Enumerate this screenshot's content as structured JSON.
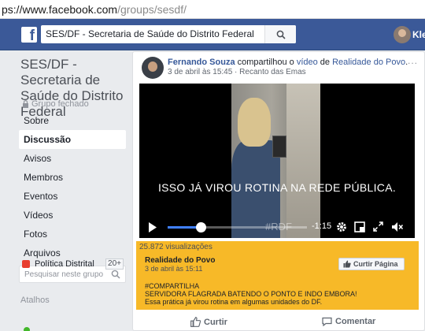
{
  "browser": {
    "url_host": "ps://www.facebook.com",
    "url_path": "/groups/sesdf/"
  },
  "topbar": {
    "logo": "f",
    "search_value": "SES/DF - Secretaria de Saúde do Distrito Federal",
    "user_name": "Kleb"
  },
  "sidebar": {
    "group_name": "SES/DF - Secretaria de Saúde do Distrito Federal",
    "group_status": "Grupo fechado",
    "nav": [
      {
        "label": "Sobre"
      },
      {
        "label": "Discussão",
        "active": true
      },
      {
        "label": "Avisos"
      },
      {
        "label": "Membros"
      },
      {
        "label": "Eventos"
      },
      {
        "label": "Vídeos"
      },
      {
        "label": "Fotos"
      },
      {
        "label": "Arquivos"
      }
    ],
    "search_placeholder": "Pesquisar neste grupo",
    "shortcuts_label": "Atalhos",
    "shortcut": {
      "label": "Política Distrital",
      "badge": "20+"
    }
  },
  "post": {
    "author": "Fernando Souza",
    "verb": " compartilhou o ",
    "object": "vídeo",
    "prep": " de ",
    "source": "Realidade do Povo",
    "tail": ".",
    "date": "3 de abril às 15:45",
    "location": "Recanto das Emas",
    "more": "...",
    "video": {
      "caption": "ISSO JÁ VIROU ROTINA NA REDE PÚBLICA.",
      "watermark": "#RDF",
      "time_left": "-1:15",
      "progress": 0.24
    },
    "views": "25.872 visualizações",
    "shared": {
      "page": "Realidade do Povo",
      "date": "3 de abril às 15:11",
      "like_page_label": "Curtir Página",
      "lines": [
        "#COMPARTILHA",
        "SERVIDORA FLAGRADA BATENDO O PONTO E INDO EMBORA!",
        "Essa prática já virou rotina em algumas unidades do DF."
      ]
    },
    "actions": {
      "like": "Curtir",
      "comment": "Comentar"
    }
  },
  "colors": {
    "facebook_blue": "#3b5998",
    "share_highlight": "#f7b928",
    "progress_blue": "#4080ff"
  }
}
